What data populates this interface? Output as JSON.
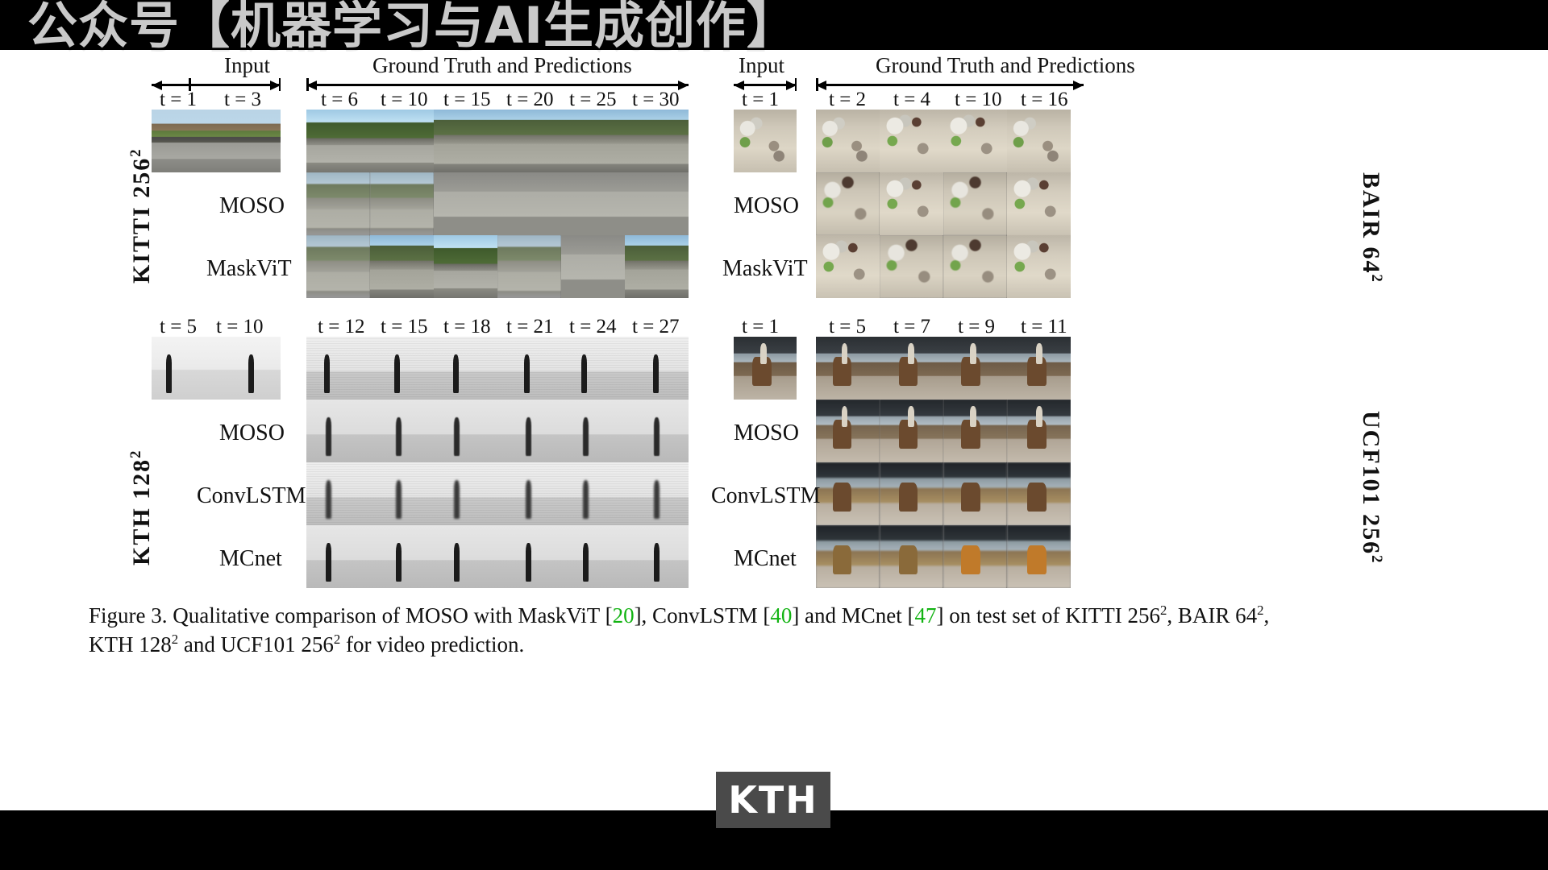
{
  "watermark": {
    "top_text": "公众号【机器学习与AI生成创作】",
    "badge_text": "KTH",
    "badge_color": "#4a4a4a"
  },
  "figure": {
    "caption_line1_a": "Figure 3. Qualitative comparison of MOSO with MaskViT [",
    "caption_ref1": "20",
    "caption_line1_b": "], ConvLSTM [",
    "caption_ref2": "40",
    "caption_line1_c": "] and MCnet [",
    "caption_ref3": "47",
    "caption_line1_d": "] on test set of KITTI 256",
    "caption_line1_e": ", BAIR 64",
    "caption_line1_f": ",",
    "caption_line2_a": "KTH 128",
    "caption_line2_b": " and UCF101 256",
    "caption_line2_c": " for video prediction.",
    "sup2": "2"
  },
  "panels": {
    "kitti": {
      "dataset_label": "KITTI  256",
      "dataset_sup": "2",
      "header_input": "Input",
      "header_gt": "Ground Truth and Predictions",
      "input_ticks": [
        "t = 1",
        "t = 3"
      ],
      "pred_ticks": [
        "t = 6",
        "t = 10",
        "t = 15",
        "t = 20",
        "t = 25",
        "t = 30"
      ],
      "row_labels": [
        "MOSO",
        "MaskViT"
      ]
    },
    "bair": {
      "dataset_label": "BAIR  64",
      "dataset_sup": "2",
      "header_input": "Input",
      "header_gt": "Ground Truth and Predictions",
      "input_ticks": [
        "t = 1"
      ],
      "pred_ticks": [
        "t = 2",
        "t = 4",
        "t = 10",
        "t = 16"
      ],
      "row_labels": [
        "MOSO",
        "MaskViT"
      ]
    },
    "kth": {
      "dataset_label": "KTH  128",
      "dataset_sup": "2",
      "input_ticks": [
        "t = 5",
        "t = 10"
      ],
      "pred_ticks": [
        "t = 12",
        "t = 15",
        "t = 18",
        "t = 21",
        "t = 24",
        "t = 27"
      ],
      "row_labels": [
        "MOSO",
        "ConvLSTM",
        "MCnet"
      ]
    },
    "ucf101": {
      "dataset_label": "UCF101  256",
      "dataset_sup": "2",
      "input_ticks": [
        "t = 1"
      ],
      "pred_ticks": [
        "t = 5",
        "t = 7",
        "t = 9",
        "t = 11"
      ],
      "row_labels": [
        "MOSO",
        "ConvLSTM",
        "MCnet"
      ]
    }
  }
}
